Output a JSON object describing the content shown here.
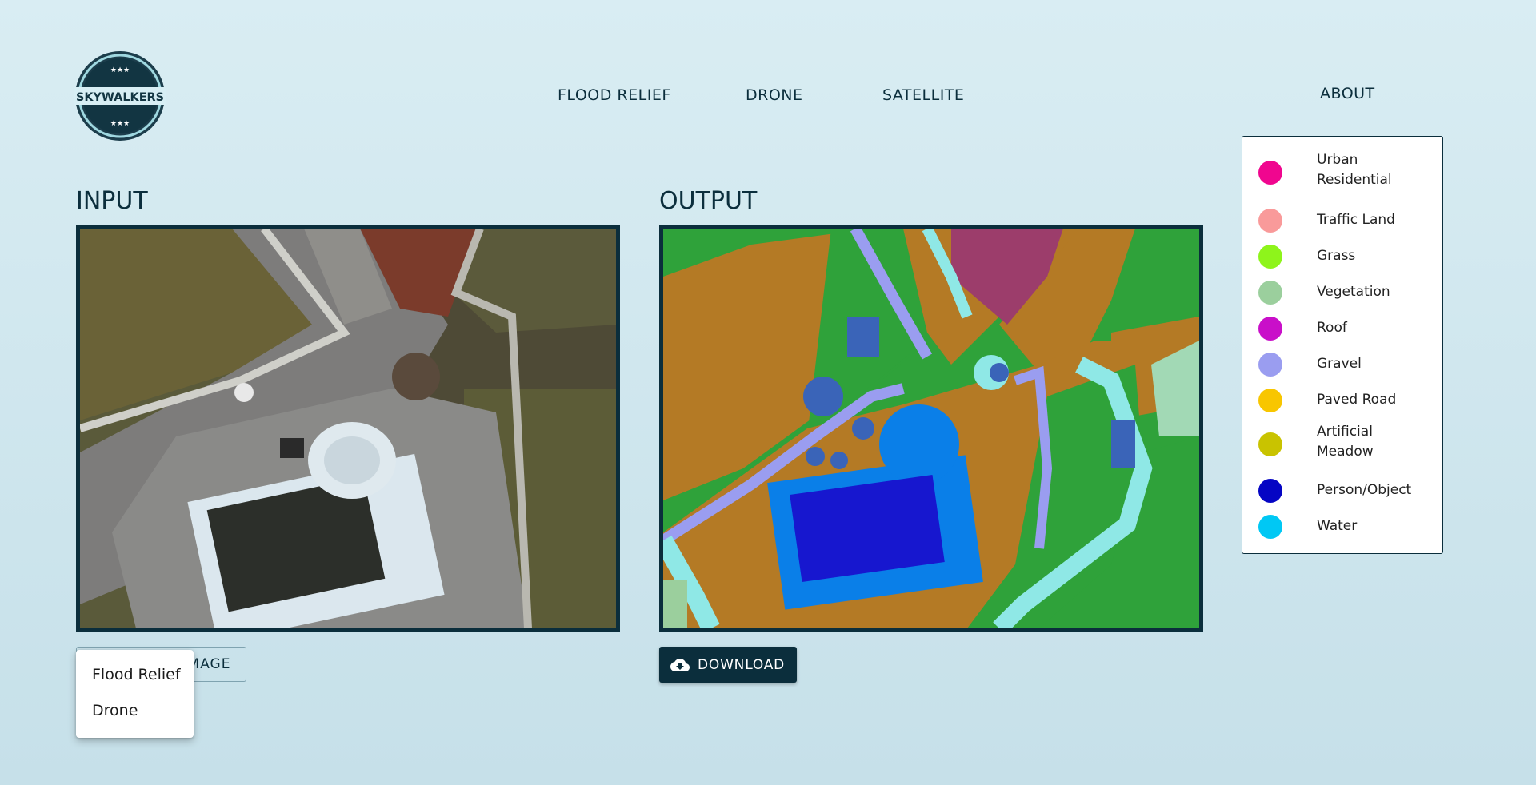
{
  "brand": {
    "logo_text": "SKYWALKERS"
  },
  "nav": {
    "items": [
      "FLOOD RELIEF",
      "DRONE",
      "SATELLITE"
    ],
    "about": "ABOUT"
  },
  "input": {
    "title": "INPUT",
    "upload_label": "MAGE"
  },
  "output": {
    "title": "OUTPUT",
    "download_label": "DOWNLOAD"
  },
  "dropdown": {
    "items": [
      "Flood Relief",
      "Drone"
    ]
  },
  "legend": {
    "items": [
      {
        "label": "Urban Residential",
        "color": "#f0068f"
      },
      {
        "label": "Traffic Land",
        "color": "#f99a9a"
      },
      {
        "label": "Grass",
        "color": "#8ef41b"
      },
      {
        "label": "Vegetation",
        "color": "#9bcf9d"
      },
      {
        "label": "Roof",
        "color": "#c90fc9"
      },
      {
        "label": "Gravel",
        "color": "#9a9df0"
      },
      {
        "label": "Paved Road",
        "color": "#f8c600"
      },
      {
        "label": "Artificial Meadow",
        "color": "#c9c300"
      },
      {
        "label": "Person/Object",
        "color": "#0505c4"
      },
      {
        "label": "Water",
        "color": "#00c8f4"
      }
    ]
  },
  "colors": {
    "primary": "#0b2e3c"
  }
}
